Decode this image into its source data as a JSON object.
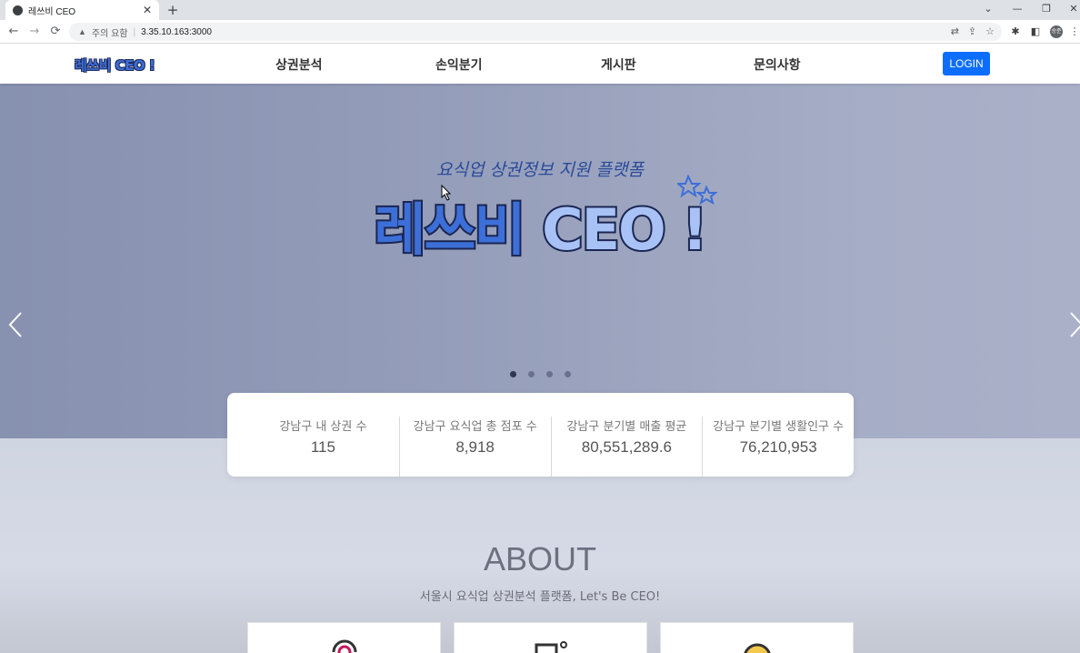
{
  "browser": {
    "tab_title": "레쓰비 CEO",
    "tab_close": "✕",
    "new_tab": "+",
    "security_label": "주의 요함",
    "separator": "|",
    "url": "3.35.10.163:3000",
    "profile_initials": "승준",
    "window_controls": {
      "chevron": "⌄",
      "minimize": "—",
      "restore": "❐",
      "close": "✕"
    },
    "nav": {
      "back": "←",
      "forward": "→",
      "reload": "⟳"
    }
  },
  "site": {
    "logo": "레쓰비 CEO !",
    "menu": [
      "상권분석",
      "손익분기",
      "게시판",
      "문의사항"
    ],
    "login_label": "LOGIN"
  },
  "hero": {
    "subtitle": "요식업 상권정보 지원 플랫폼",
    "title_main": "레쓰비 ",
    "title_ceo": "CEO !",
    "slides_count": 4,
    "active_slide": 1
  },
  "stats": [
    {
      "label": "강남구 내 상권 수",
      "value": "115"
    },
    {
      "label": "강남구 요식업 총 점포 수",
      "value": "8,918"
    },
    {
      "label": "강남구 분기별 매출 평균",
      "value": "80,551,289.6"
    },
    {
      "label": "강남구 분기별 생활인구 수",
      "value": "76,210,953"
    }
  ],
  "about": {
    "title": "ABOUT",
    "subtitle": "서울시 요식업 상권분석 플랫폼, Let's Be CEO!"
  },
  "colors": {
    "brand_blue": "#3d6fd8",
    "login_blue": "#0d6efd",
    "hero_bg": "#949db9"
  }
}
